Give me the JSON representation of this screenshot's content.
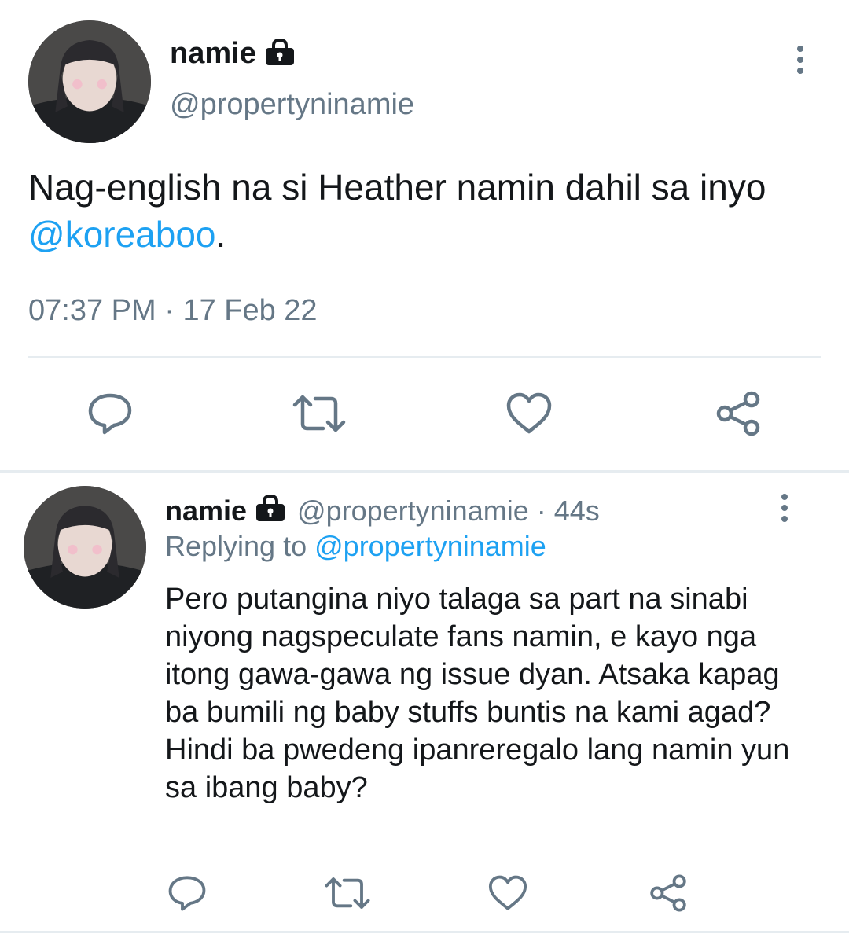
{
  "main_tweet": {
    "display_name": "namie",
    "handle": "@propertyninamie",
    "text_before": "Nag-english na si Heather namin dahil sa inyo ",
    "mention": "@koreaboo",
    "text_after": ".",
    "time": "07:37 PM",
    "separator": "·",
    "date": "17 Feb 22"
  },
  "reply_tweet": {
    "display_name": "namie",
    "handle": "@propertyninamie",
    "age": "· 44s",
    "replying_label": "Replying to",
    "replying_to": "@propertyninamie",
    "text": "Pero putangina niyo talaga sa part na sinabi niyong nagspeculate fans namin, e kayo nga itong gawa-gawa ng issue dyan. Atsaka kapag ba bumili ng baby stuffs buntis na kami agad? Hindi ba pwedeng ipanreregalo lang namin yun sa ibang baby?"
  },
  "icons": [
    "lock-icon",
    "more-icon",
    "reply-icon",
    "retweet-icon",
    "like-icon",
    "share-icon"
  ],
  "colors": {
    "accent": "#1da1f2",
    "secondary_text": "#657786",
    "divider": "#e6ecf0"
  }
}
